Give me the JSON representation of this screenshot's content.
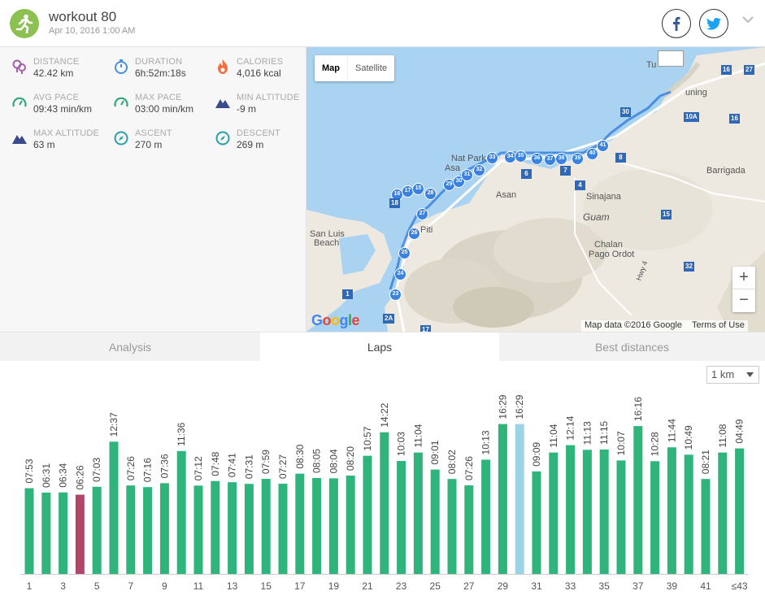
{
  "header": {
    "title": "workout 80",
    "date": "Apr 10, 2016 1:00 AM"
  },
  "stats": [
    {
      "label": "DISTANCE",
      "value": "42.42 km",
      "icon": "location-pins-icon",
      "color": "#a55fa8"
    },
    {
      "label": "DURATION",
      "value": "6h:52m:18s",
      "icon": "stopwatch-icon",
      "color": "#4a90d9"
    },
    {
      "label": "CALORIES",
      "value": "4,016 kcal",
      "icon": "flame-icon",
      "color": "#f07040"
    },
    {
      "label": "AVG PACE",
      "value": "09:43 min/km",
      "icon": "speedometer-icon",
      "color": "#2da67a"
    },
    {
      "label": "MAX PACE",
      "value": "03:00 min/km",
      "icon": "speedometer-icon",
      "color": "#2da67a"
    },
    {
      "label": "MIN ALTITUDE",
      "value": "-9 m",
      "icon": "mountain-icon",
      "color": "#3a4a8a"
    },
    {
      "label": "MAX ALTITUDE",
      "value": "63 m",
      "icon": "mountain-icon",
      "color": "#3a4a8a"
    },
    {
      "label": "ASCENT",
      "value": "270 m",
      "icon": "compass-icon",
      "color": "#2a9fa8"
    },
    {
      "label": "DESCENT",
      "value": "269 m",
      "icon": "compass-icon",
      "color": "#2a9fa8"
    }
  ],
  "map": {
    "type_map": "Map",
    "type_satellite": "Satellite",
    "labels": {
      "nat_park": "Nat Park",
      "asan_short": "Asa",
      "asan": "Asan",
      "sinajana": "Sinajana",
      "guam": "Guam",
      "barrigada": "Barrigada",
      "piti": "Piti",
      "san_luis": "San Luis",
      "beach": "Beach",
      "chalan": "Chalan",
      "pago_ordot": "Pago Ordot",
      "tamuning": "uning",
      "tum": "Tu",
      "hwy": "Hwy 4"
    },
    "route_numbers": [
      "16",
      "17",
      "15",
      "28",
      "29",
      "30",
      "31",
      "32",
      "33",
      "34",
      "35",
      "36",
      "37",
      "38",
      "39",
      "40",
      "41",
      "27",
      "26",
      "25",
      "24",
      "23"
    ],
    "road_shields": [
      "27",
      "16",
      "30",
      "10A",
      "16",
      "8",
      "7",
      "6",
      "4",
      "18",
      "15",
      "1",
      "2A",
      "17",
      "32"
    ],
    "google": "Google",
    "attribution": "Map data ©2016 Google",
    "terms": "Terms of Use",
    "zoom_in": "+",
    "zoom_out": "−"
  },
  "tabs": [
    "Analysis",
    "Laps",
    "Best distances"
  ],
  "unit_select": "1 km",
  "colors": {
    "bar": "#2fb47b",
    "bar_highlight": "#b5446a",
    "bar_selected": "#9dd3e6"
  },
  "chart_data": {
    "type": "bar",
    "categories": [
      "1",
      "2",
      "3",
      "4",
      "5",
      "6",
      "7",
      "8",
      "9",
      "10",
      "11",
      "12",
      "13",
      "14",
      "15",
      "16",
      "17",
      "18",
      "19",
      "20",
      "21",
      "22",
      "23",
      "24",
      "25",
      "26",
      "27",
      "28",
      "29",
      "30",
      "31",
      "32",
      "33",
      "34",
      "35",
      "36",
      "37",
      "38",
      "39",
      "40",
      "41",
      "42",
      "≤43"
    ],
    "x_tick_labels": [
      "1",
      "3",
      "5",
      "7",
      "9",
      "11",
      "13",
      "15",
      "17",
      "19",
      "21",
      "23",
      "25",
      "27",
      "29",
      "31",
      "33",
      "35",
      "37",
      "39",
      "41",
      "≤43"
    ],
    "values": [
      "07:53",
      "06:31",
      "06:34",
      "06:26",
      "07:03",
      "12:37",
      "07:26",
      "07:16",
      "07:36",
      "11:36",
      "07:12",
      "07:48",
      "07:41",
      "07:31",
      "07:59",
      "07:27",
      "08:30",
      "08:05",
      "08:04",
      "08:20",
      "10:57",
      "14:22",
      "10:03",
      "11:04",
      "09:01",
      "08:02",
      "07:26",
      "10:13",
      "16:29",
      "16:29",
      "09:09",
      "11:04",
      "12:14",
      "11:13",
      "11:15",
      "10:07",
      "16:16",
      "10:28",
      "11:44",
      "10:49",
      "08:21",
      "11:08",
      "04:49"
    ],
    "bar_heights_value": [
      79.1,
      75.0,
      75.2,
      73.1,
      80.4,
      122.0,
      81.6,
      80.1,
      83.7,
      113.4,
      81.5,
      85.7,
      84.6,
      83.1,
      87.7,
      83.2,
      92.5,
      88.5,
      88.2,
      90.7,
      109.0,
      130.7,
      104.2,
      112.0,
      96.3,
      87.6,
      81.7,
      105.4,
      138.3,
      138.3,
      94.6,
      112.0,
      118.8,
      114.5,
      114.8,
      104.7,
      136.4,
      104.0,
      116.8,
      110.0,
      87.6,
      112.0,
      115.8
    ],
    "highlight_index": 3,
    "selected_index": 29,
    "ylim": [
      0,
      150
    ]
  }
}
